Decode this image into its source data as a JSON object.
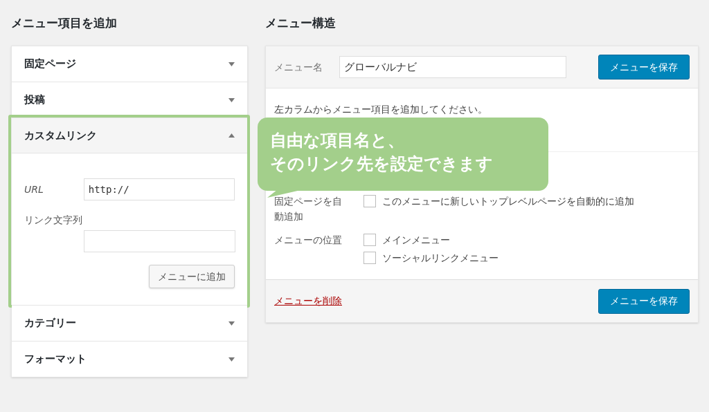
{
  "left": {
    "heading": "メニュー項目を追加",
    "sections": [
      {
        "title": "固定ページ",
        "expanded": false
      },
      {
        "title": "投稿",
        "expanded": false
      },
      {
        "title": "カスタムリンク",
        "expanded": true,
        "highlighted": true,
        "fields": [
          {
            "label": "URL",
            "value": "http://"
          },
          {
            "label": "リンク文字列"
          }
        ],
        "button": "メニューに追加"
      },
      {
        "title": "カテゴリー",
        "expanded": false
      },
      {
        "title": "フォーマット",
        "expanded": false
      }
    ]
  },
  "right": {
    "heading": "メニュー構造",
    "name_label": "メニュー名",
    "name_value": "グローバルナビ",
    "save_button": "メニューを保存",
    "instruction": "左カラムからメニュー項目を追加してください。",
    "settings": [
      {
        "label": "固定ページを自動追加",
        "options": [
          {
            "label": "このメニューに新しいトップレベルページを自動的に追加",
            "checked": false
          }
        ]
      },
      {
        "label": "メニューの位置",
        "options": [
          {
            "label": "メインメニュー",
            "checked": false
          },
          {
            "label": "ソーシャルリンクメニュー",
            "checked": false
          }
        ]
      }
    ],
    "delete_link": "メニューを削除",
    "footer_save_button": "メニューを保存"
  },
  "callout": {
    "lines": [
      "自由な項目名と、",
      "そのリンク先を設定できます"
    ]
  }
}
